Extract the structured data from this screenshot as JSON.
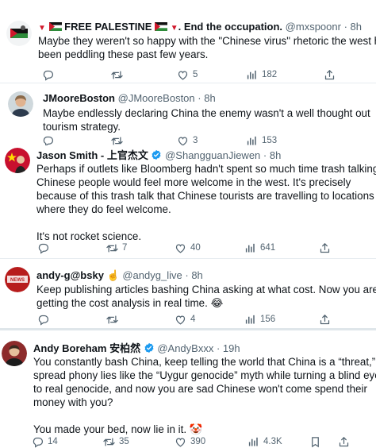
{
  "tweets": [
    {
      "name": "🔻🇵🇸FREE PALESTINE🇵🇸🔻. End the occupation.",
      "name_display": "FREE PALESTINE",
      "name_suffix": ". End the occupation.",
      "handle": "@mxspoonr",
      "time": "8h",
      "lines": [
        "Maybe they weren't so happy with the \"Chinese virus\" rhetoric the west has",
        "been peddling these past few years."
      ],
      "replies": "",
      "retweets": "",
      "likes": "5",
      "views": "182"
    },
    {
      "name": "JMooreBoston",
      "handle": "@JMooreBoston",
      "time": "8h",
      "lines": [
        "Maybe endlessly declaring China the enemy wasn't a well thought out",
        "tourism strategy."
      ],
      "replies": "",
      "retweets": "",
      "likes": "3",
      "views": "153"
    },
    {
      "name": "Jason Smith - 上官杰文",
      "handle": "@ShangguanJiewen",
      "time": "8h",
      "lines": [
        "Perhaps if outlets like Bloomberg hadn't spent so much time trash talking,",
        "Chinese people would feel more welcome in the west. It's precisely",
        "because of this trash talk that Chinese tourists are travelling to locations",
        "where they do feel welcome.",
        "",
        "It's not rocket science."
      ],
      "replies": "",
      "retweets": "7",
      "likes": "40",
      "views": "641"
    },
    {
      "name": "andy-g@bsky",
      "name_emoji": "☝️",
      "handle": "@andyg_live",
      "time": "8h",
      "lines": [
        "Keep publishing articles bashing China asking at what cost. Now you are",
        "getting the cost analysis in real time. 😂"
      ],
      "replies": "",
      "retweets": "",
      "likes": "4",
      "views": "156"
    },
    {
      "name": "Andy Boreham 安柏然",
      "handle": "@AndyBxxx",
      "time": "19h",
      "lines": [
        "You constantly bash China, keep telling the world that China is a “threat,”",
        "spread phony lies like the “Uygur genocide” myth while turning a blind eye",
        "to real genocide, and now you are sad Chinese won't come spend their",
        "money with you?",
        "",
        "You made your bed, now lie in it. 🤡"
      ],
      "replies": "14",
      "retweets": "35",
      "likes": "390",
      "views": "4.3K"
    }
  ],
  "colors": {
    "text": "#0f1419",
    "muted": "#536471",
    "verified": "#1d9bf0",
    "separator": "#e6ecf0"
  }
}
